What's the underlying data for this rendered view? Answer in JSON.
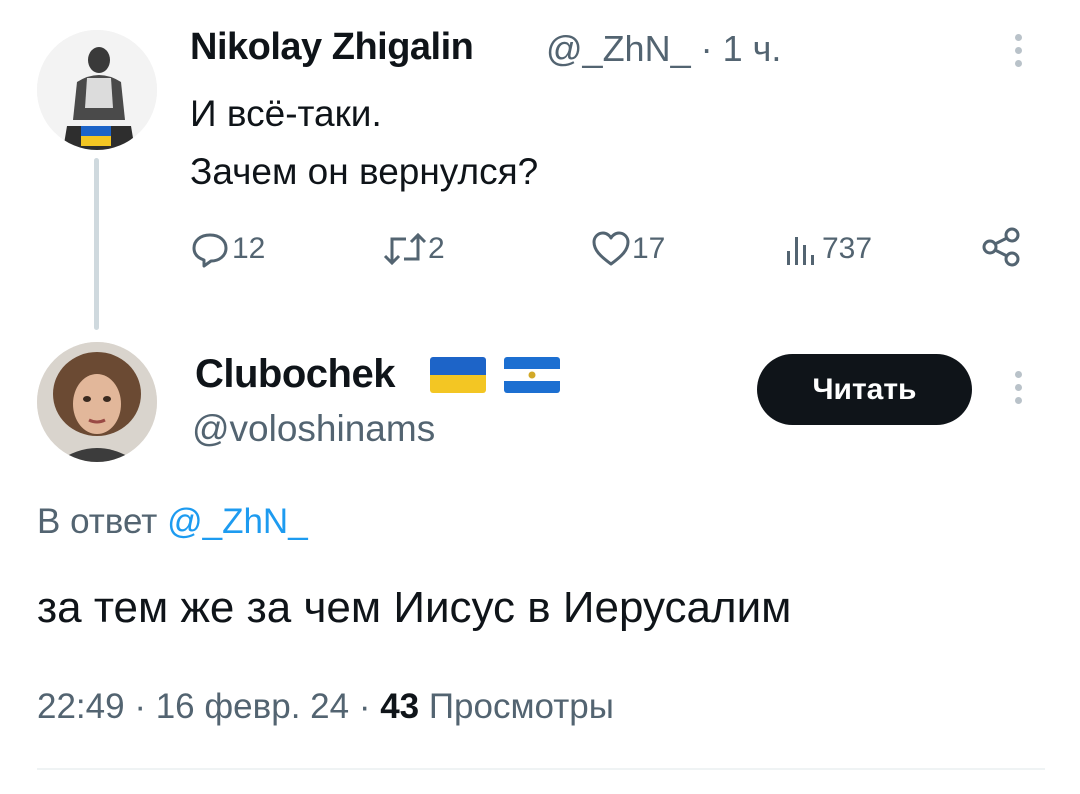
{
  "parent_tweet": {
    "author_name": "Nikolay Zhigalin",
    "handle": "@_ZhN_",
    "time": "· 1 ч.",
    "text_line1": "И всё-таки.",
    "text_line2": "Зачем он вернулся?",
    "stats": {
      "replies": "12",
      "reposts": "2",
      "likes": "17",
      "views": "737"
    },
    "icons": [
      "more-icon",
      "reply-icon",
      "retweet-icon",
      "like-icon",
      "views-icon",
      "share-icon"
    ]
  },
  "reply_tweet": {
    "author_name": "Clubochek",
    "flags": [
      "ukraine-flag",
      "nicaragua-flag"
    ],
    "handle": "@voloshinams",
    "follow_label": "Читать",
    "reply_to_prefix": "В ответ",
    "reply_to_handle": "@_ZhN_",
    "text": "за тем же за чем Иисус в Иерусалим",
    "time": "22:49",
    "date": "16 февр. 24",
    "views_count": "43",
    "views_label": "Просмотры"
  },
  "colors": {
    "text": "#0f1419",
    "secondary": "#536471",
    "link": "#1d9bf0",
    "button_bg": "#0f1419",
    "thread_line": "#cfd9de"
  }
}
